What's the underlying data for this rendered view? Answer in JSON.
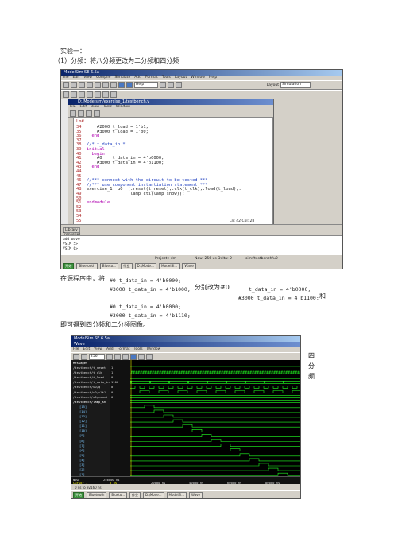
{
  "heading": "实验一：",
  "subheading": "（1）分频：将八分频更改为二分频和四分频",
  "para": {
    "p1_pre": "在源程序中，将",
    "p1_code_a": "#0    t_data_in = 4'b0000;",
    "p1_code_b": "#3000 t_data_in = 4'b1000;",
    "p1_mid": "分别改为#0",
    "p1_code_c": "t_data_in = 4'b0000;",
    "p1_code_d": "#3000 t_data_in = 4'b1100;",
    "p1_and": "和",
    "p2_code_a": "#0    t_data_in = 4'b0000;",
    "p2_code_b": "#3000 t_data_in = 4'b1110;",
    "p3": "即可得到四分频和二分频图像。"
  },
  "side_label": [
    "四",
    "分",
    "频"
  ],
  "shot1": {
    "title": "ModelSim SE 6.5a",
    "menu": [
      "File",
      "Edit",
      "View",
      "Compile",
      "Simulate",
      "Add",
      "Format",
      "Tools",
      "Layout",
      "Window",
      "Help"
    ],
    "help_field": "Help",
    "layout_label": "Layout",
    "layout_value": "Simulation",
    "editor_title": "D:/Modelsim/exercise_1/testbench.v",
    "editor_menu": [
      "File",
      "Edit",
      "View",
      "Tools",
      "Window"
    ],
    "ln_header": "Ln#",
    "code_lines": [
      {
        "n": "34",
        "t": "    #2000 t_load = 1'b1;",
        "c": "plain"
      },
      {
        "n": "35",
        "t": "    #3000 t_load = 1'b0;",
        "c": "plain"
      },
      {
        "n": "36",
        "t": "  end",
        "c": "kw"
      },
      {
        "n": "37",
        "t": "",
        "c": "plain"
      },
      {
        "n": "38",
        "t": "//* t_data_in *",
        "c": "cm"
      },
      {
        "n": "39",
        "t": "initial",
        "c": "kw"
      },
      {
        "n": "40",
        "t": "  begin",
        "c": "kw"
      },
      {
        "n": "41",
        "t": "    #0    t_data_in = 4'b0000;",
        "c": "plain"
      },
      {
        "n": "42",
        "t": "    #3000 t_data_in = 4'b1100;",
        "c": "plain"
      },
      {
        "n": "43",
        "t": "  end",
        "c": "kw"
      },
      {
        "n": "44",
        "t": "",
        "c": "plain"
      },
      {
        "n": "45",
        "t": "",
        "c": "plain"
      },
      {
        "n": "46",
        "t": "//*** connect with the circuit to be tested ***",
        "c": "cm"
      },
      {
        "n": "47",
        "t": "//*** use component instantiation statement ***",
        "c": "cm"
      },
      {
        "n": "48",
        "t": "exercise_1  u0  (.reset(t_reset),.clk(t_clk),.load(t_load),.",
        "c": "plain"
      },
      {
        "n": "49",
        "t": "                .lamp_ctl(lamp_show));",
        "c": "plain"
      },
      {
        "n": "50",
        "t": "",
        "c": "plain"
      },
      {
        "n": "51",
        "t": "endmodule",
        "c": "kw"
      },
      {
        "n": "52",
        "t": "",
        "c": "plain"
      },
      {
        "n": "53",
        "t": "",
        "c": "plain"
      },
      {
        "n": "54",
        "t": "",
        "c": "plain"
      },
      {
        "n": "55",
        "t": "",
        "c": "plain"
      }
    ],
    "cursor_pos": "Ln: 42 Col: 28",
    "tab_library": "Library",
    "tab_transcript": "Transcript",
    "transcript_lines": [
      "add wave",
      "VSIM 5>",
      "VSIM 6>"
    ],
    "status_project": "Project : dm",
    "status_now": "Now: 256 us  Delta: 2",
    "status_sim": "sim:/testbench/u0",
    "taskbar": [
      "开始",
      "Bluetooth",
      "Blueto...",
      "作业",
      "D:\\Mode...",
      "ModelSi...",
      "Wave"
    ]
  },
  "shot2": {
    "title": "ModelSim SE 6.5a",
    "window_title": "Wave",
    "menu": [
      "File",
      "Edit",
      "View",
      "Add",
      "Format",
      "Tools",
      "Window"
    ],
    "zoom_value": "256",
    "col_header_msgs": "Messages",
    "signals": [
      {
        "name": "/testbench/t_reset",
        "val": "1"
      },
      {
        "name": "/testbench/t_clk",
        "val": "1"
      },
      {
        "name": "/testbench/t_load",
        "val": "0"
      },
      {
        "name": "/testbench/t_data_in",
        "val": "1100"
      },
      {
        "name": "/testbench/u0/q",
        "val": "0"
      },
      {
        "name": "/testbench/u0/clk1",
        "val": "0"
      },
      {
        "name": "/testbench/u0/count",
        "val": "0"
      },
      {
        "name": "/testbench/lamp_sh",
        "val": ""
      },
      {
        "name": "[15]",
        "val": ""
      },
      {
        "name": "[14]",
        "val": ""
      },
      {
        "name": "[13]",
        "val": ""
      },
      {
        "name": "[12]",
        "val": ""
      },
      {
        "name": "[11]",
        "val": ""
      },
      {
        "name": "[10]",
        "val": ""
      },
      {
        "name": "[9]",
        "val": ""
      },
      {
        "name": "[8]",
        "val": ""
      },
      {
        "name": "[7]",
        "val": ""
      },
      {
        "name": "[6]",
        "val": ""
      },
      {
        "name": "[5]",
        "val": ""
      },
      {
        "name": "[4]",
        "val": ""
      },
      {
        "name": "[3]",
        "val": ""
      },
      {
        "name": "[2]",
        "val": ""
      },
      {
        "name": "[1]",
        "val": ""
      },
      {
        "name": "[0]",
        "val": ""
      }
    ],
    "now_label": "Now",
    "now_value": "256000 ns",
    "cursor_label": "Cursor 1",
    "cursor_value": "0 ns",
    "ticks": [
      "20000 ns",
      "40000 ns",
      "60000 ns",
      "80000 ns"
    ],
    "status": "0 ns to 92160 ns",
    "taskbar": [
      "开始",
      "Bluetooth",
      "Blueto...",
      "作业",
      "D:\\Mode...",
      "ModelSi...",
      "Wave"
    ]
  }
}
